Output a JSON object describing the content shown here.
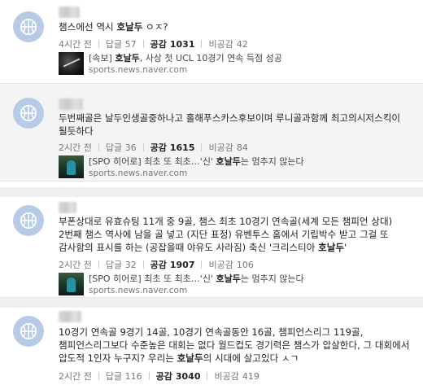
{
  "comments": [
    {
      "text": "챔스에선 역시 호날두 ㅇㅈ?",
      "time": "4시간 전",
      "reply_label": "답글",
      "reply_count": "57",
      "like_label": "공감",
      "like_count": "1031",
      "dislike_label": "비공감",
      "dislike_count": "42",
      "link_title": "[속보] 호날두, 사상 첫 UCL 10경기 연속 득점 성공",
      "link_source": "sports.news.naver.com"
    },
    {
      "text": "두번째골은 날두인생골중하나고 홀해푸스카스후보이며 루니골과함께 최고의시저스킥이 될듯하다",
      "time": "2시간 전",
      "reply_label": "답글",
      "reply_count": "36",
      "like_label": "공감",
      "like_count": "1615",
      "dislike_label": "비공감",
      "dislike_count": "84",
      "link_title": "[SPO 히어로] 최초 또 최초…'신' 호날두는 멈추지 않는다",
      "link_source": "sports.news.naver.com"
    },
    {
      "text": "부폰상대로 유효슈팅 11개 중 9골, 챔스 최초 10경기 연속골(세계 모든 챔피언 상대) 2번째 챔스 역사에 남을 골 넣고 (지단 표정) 유벤투스 홈에서 기립박수 받고 그걸 또 감사함의 표시를 하는 (공잡을때 야유도 사라짐) 축신 '크리스티아 호날두'",
      "time": "2시간 전",
      "reply_label": "답글",
      "reply_count": "32",
      "like_label": "공감",
      "like_count": "1907",
      "dislike_label": "비공감",
      "dislike_count": "106",
      "link_title": "[SPO 히어로] 최초 또 최초…'신' 호날두는 멈추지 않는다",
      "link_source": "sports.news.naver.com"
    },
    {
      "text": "10경기 연속골 9경기 14골, 10경기 연속골동안 16골, 챔피언스리그 119골, 챔피언스리그보다 수준높은 대회는 없다 월드컵도 경기력은 챔스가 압살한다, 그 대회에서 압도적 1인자 누구지? 우리는 호날두의 시대에 살고있다 ㅅㄱ",
      "time": "2시간 전",
      "reply_label": "답글",
      "reply_count": "116",
      "like_label": "공감",
      "like_count": "3040",
      "dislike_label": "비공감",
      "dislike_count": "419"
    }
  ]
}
